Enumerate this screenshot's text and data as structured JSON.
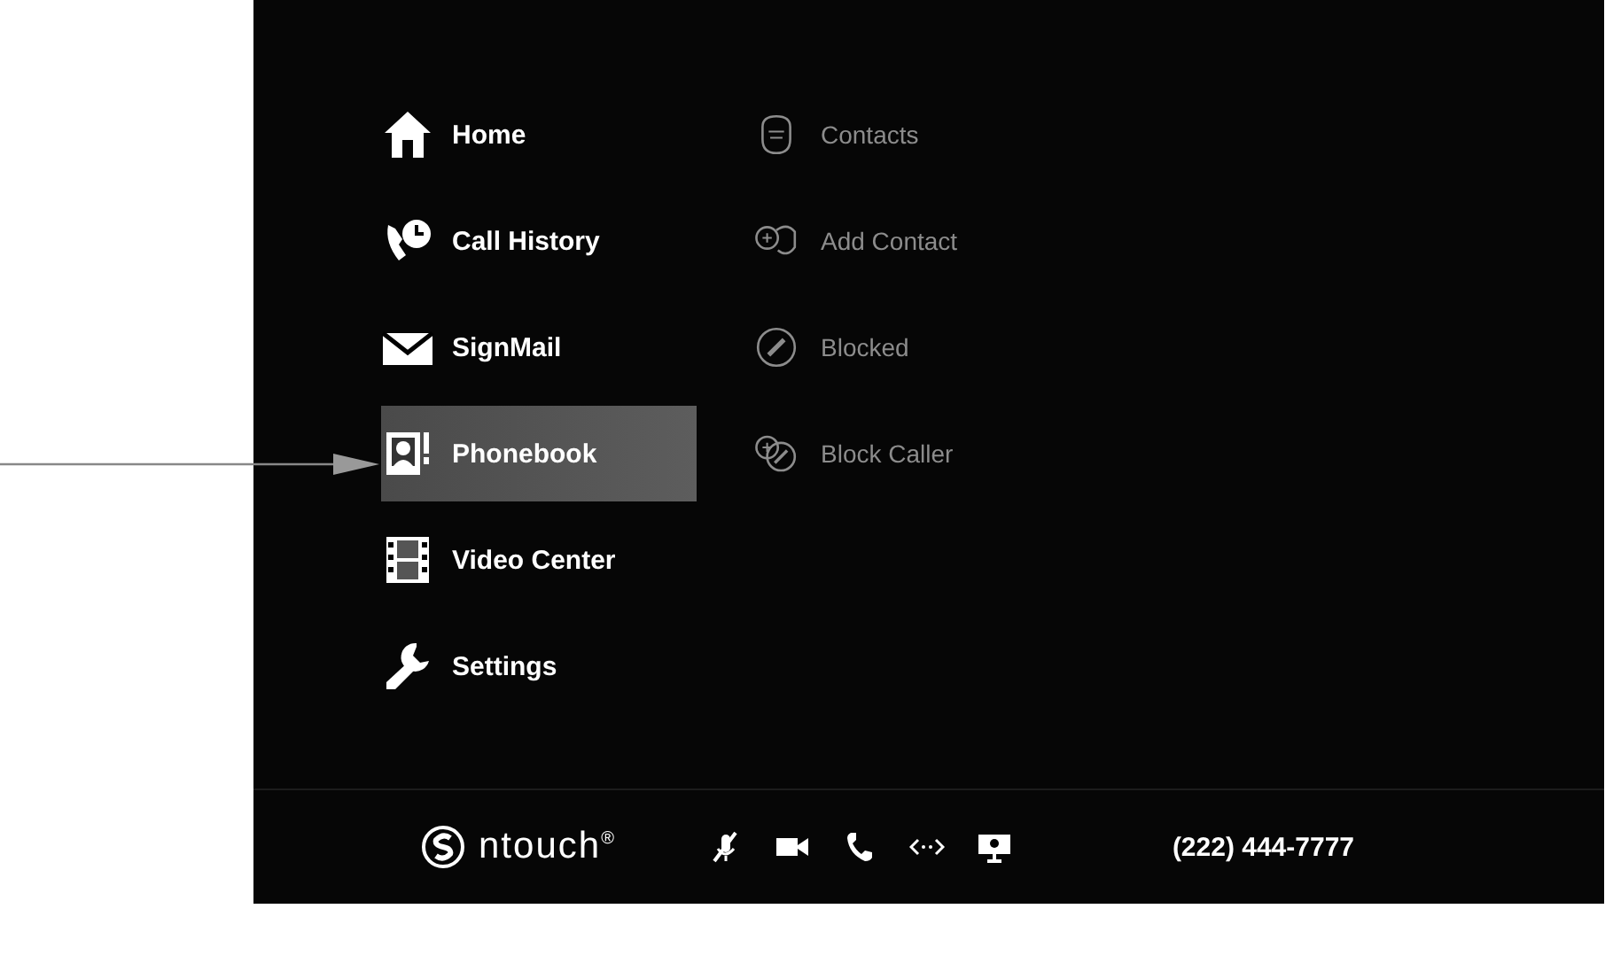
{
  "menu": [
    {
      "label": "Home",
      "selected": false
    },
    {
      "label": "Call History",
      "selected": false
    },
    {
      "label": "SignMail",
      "selected": false
    },
    {
      "label": "Phonebook",
      "selected": true
    },
    {
      "label": "Video Center",
      "selected": false
    },
    {
      "label": "Settings",
      "selected": false
    }
  ],
  "submenu": [
    {
      "label": "Contacts",
      "disabled": true
    },
    {
      "label": "Add Contact",
      "disabled": true
    },
    {
      "label": "Blocked",
      "disabled": true
    },
    {
      "label": "Block Caller",
      "disabled": true
    }
  ],
  "status_bar": {
    "brand": "ntouch$^{®}$",
    "phone_number": "(222) 444-7777"
  }
}
